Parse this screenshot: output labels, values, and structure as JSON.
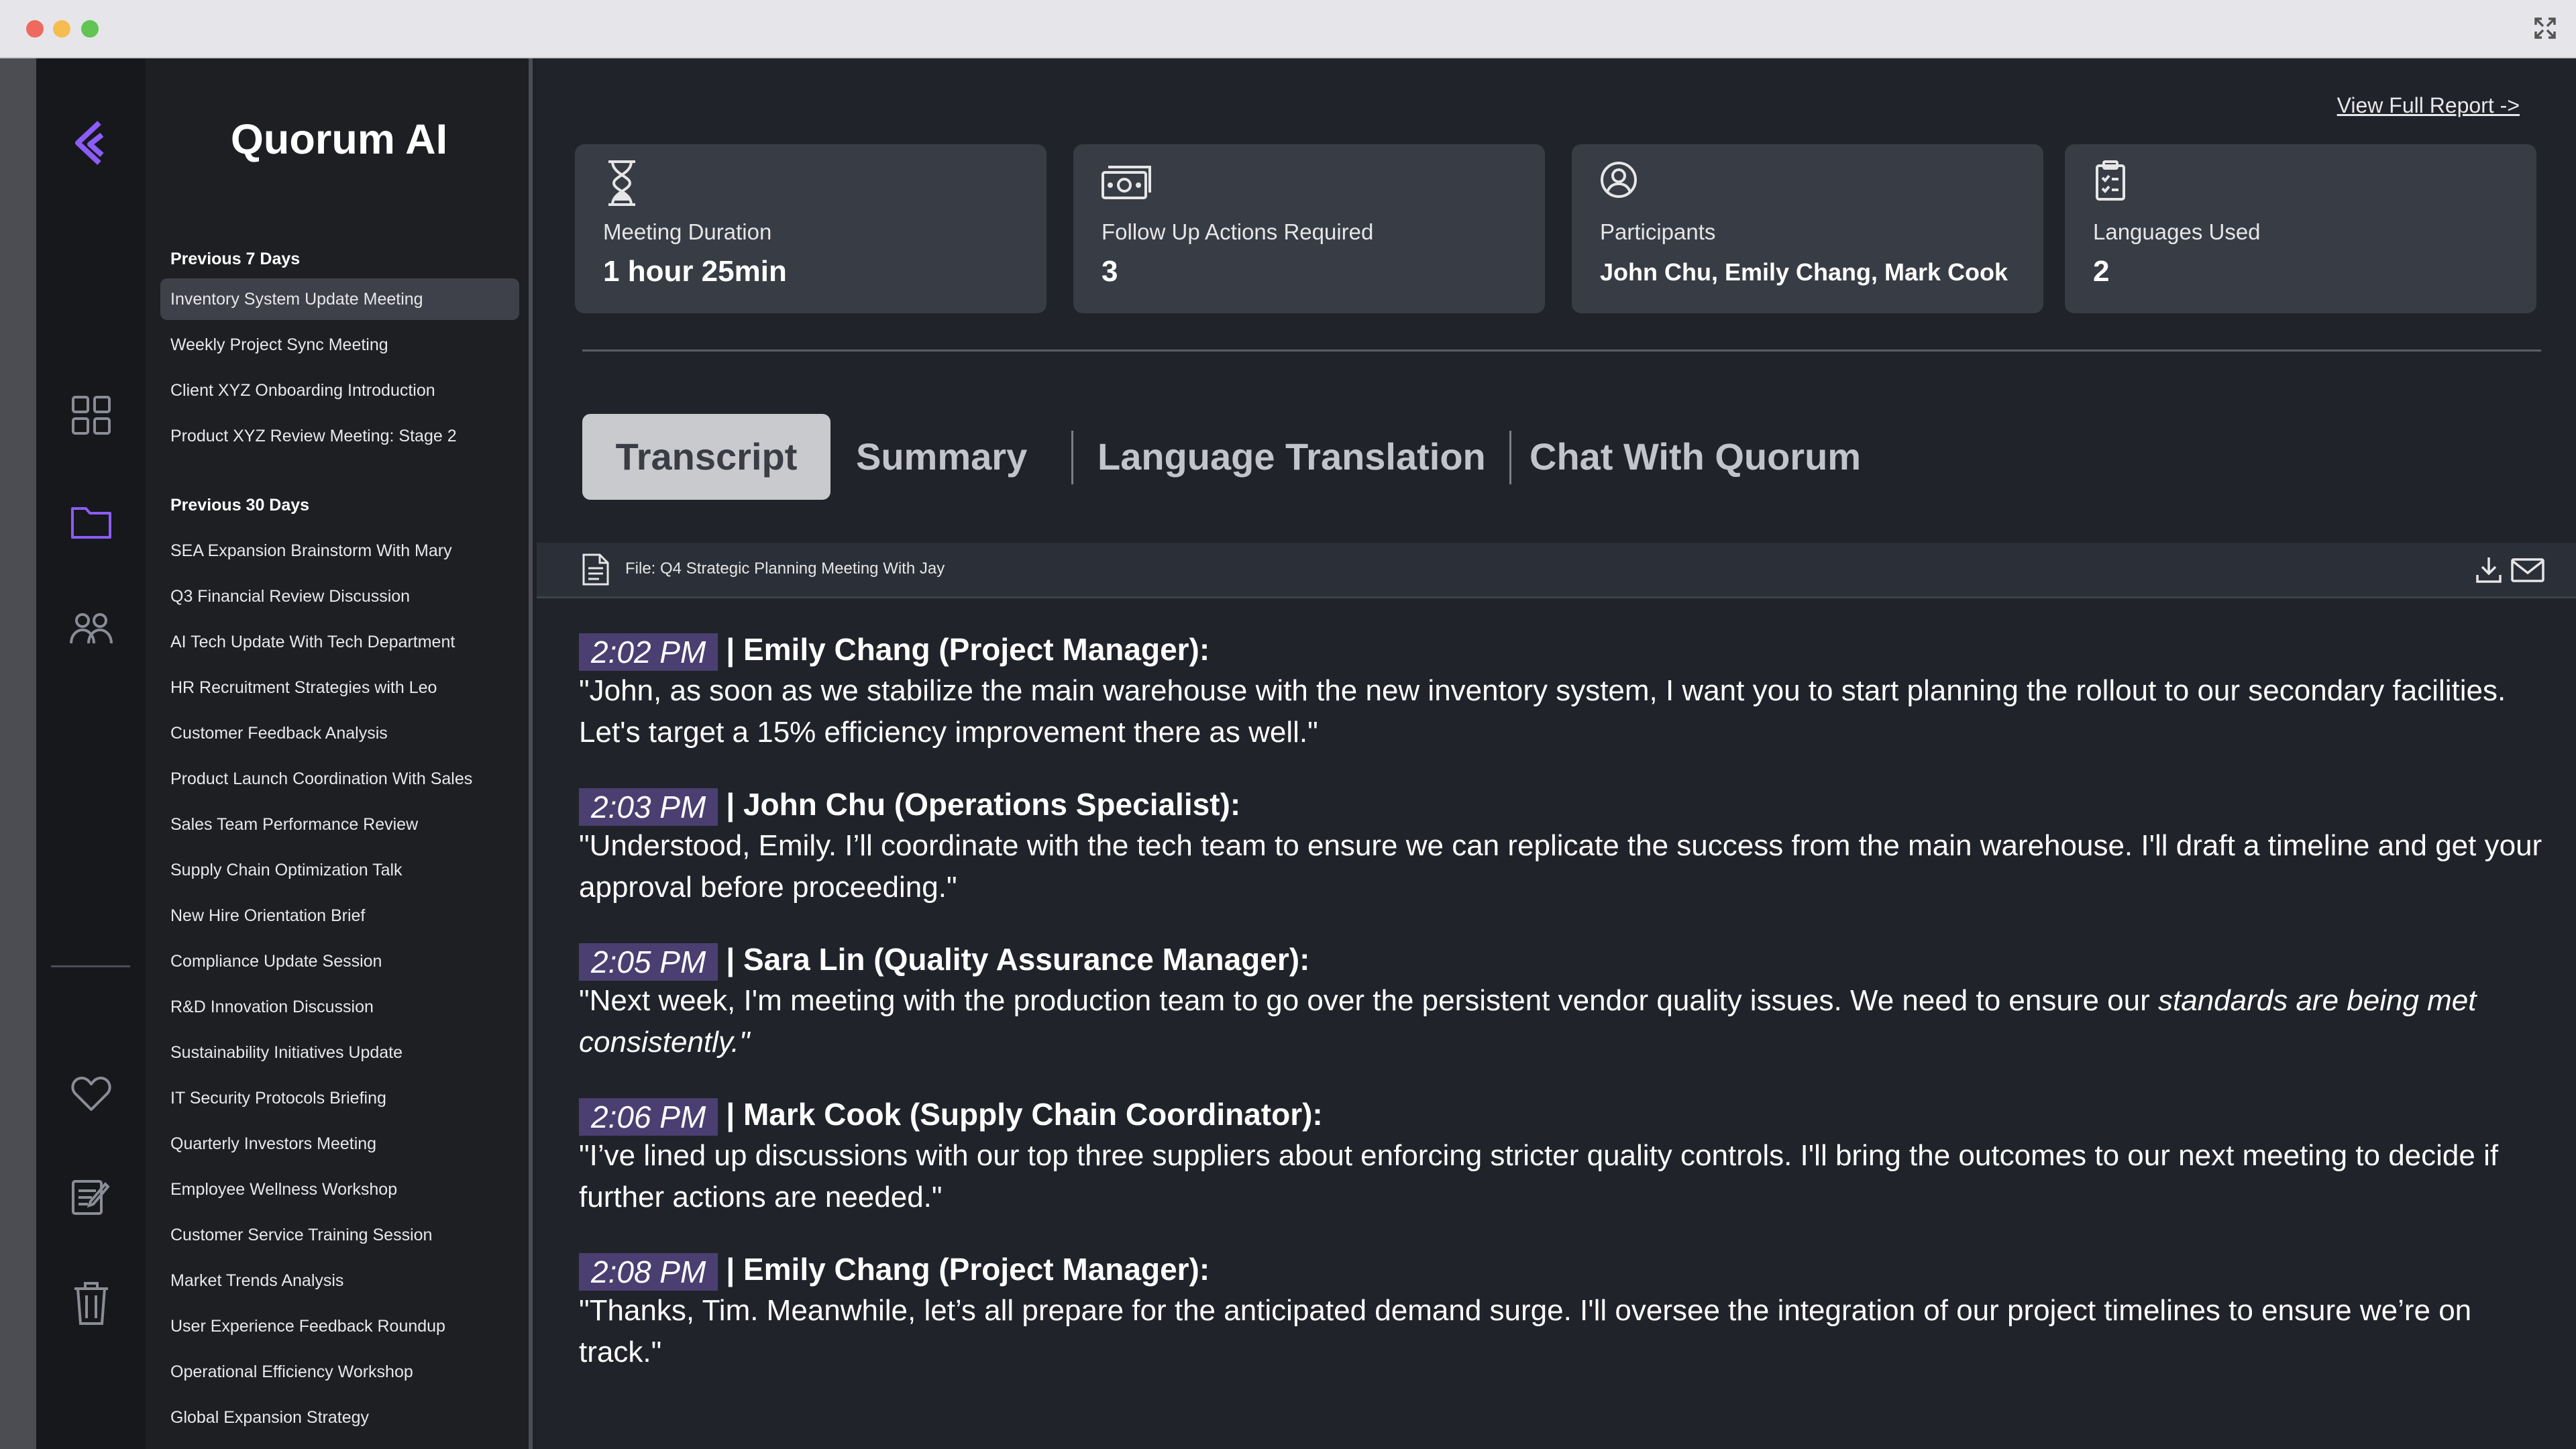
{
  "app": {
    "name": "Quorum AI",
    "accent": "#8b5cf6"
  },
  "sidebar": {
    "sections": [
      {
        "title": "Previous 7 Days",
        "items": [
          {
            "label": "Inventory System Update Meeting",
            "active": true
          },
          {
            "label": "Weekly Project Sync Meeting"
          },
          {
            "label": "Client XYZ Onboarding Introduction"
          },
          {
            "label": "Product XYZ Review Meeting: Stage 2"
          }
        ]
      },
      {
        "title": "Previous 30 Days",
        "items": [
          {
            "label": "SEA Expansion Brainstorm With Mary"
          },
          {
            "label": "Q3 Financial Review Discussion"
          },
          {
            "label": "AI Tech Update With Tech Department"
          },
          {
            "label": "HR Recruitment Strategies with Leo"
          },
          {
            "label": "Customer Feedback Analysis"
          },
          {
            "label": "Product Launch Coordination With Sales"
          },
          {
            "label": "Sales Team Performance Review"
          },
          {
            "label": "Supply Chain Optimization Talk"
          },
          {
            "label": "New Hire Orientation Brief"
          },
          {
            "label": "Compliance Update Session"
          },
          {
            "label": "R&D Innovation Discussion"
          },
          {
            "label": "Sustainability Initiatives Update"
          },
          {
            "label": "IT Security Protocols Briefing"
          },
          {
            "label": "Quarterly Investors Meeting"
          },
          {
            "label": "Employee Wellness Workshop"
          },
          {
            "label": "Customer Service Training Session"
          },
          {
            "label": "Market Trends Analysis"
          },
          {
            "label": "User Experience Feedback Roundup"
          },
          {
            "label": "Operational Efficiency Workshop"
          },
          {
            "label": "Global Expansion Strategy"
          }
        ]
      }
    ]
  },
  "rail": {
    "icons": [
      "quorum-logo-icon",
      "dashboard-grid-icon",
      "folder-icon",
      "users-icon",
      "heart-icon",
      "notes-edit-icon",
      "trash-icon"
    ]
  },
  "header": {
    "report_link": "View Full Report ->"
  },
  "stats": [
    {
      "icon": "hourglass-icon",
      "label": "Meeting Duration",
      "value": "1 hour 25min"
    },
    {
      "icon": "money-icon",
      "label": "Follow Up Actions Required",
      "value": "3"
    },
    {
      "icon": "user-circle-icon",
      "label": "Participants",
      "value": "John Chu, Emily Chang, Mark Cook"
    },
    {
      "icon": "clipboard-icon",
      "label": "Languages Used",
      "value": "2"
    }
  ],
  "tabs": [
    {
      "label": "Transcript",
      "active": true
    },
    {
      "label": "Summary"
    },
    {
      "label": "Language Translation"
    },
    {
      "label": "Chat With Quorum"
    }
  ],
  "file": {
    "name": "File: Q4 Strategic Planning Meeting With Jay"
  },
  "transcript": [
    {
      "time": "2:02 PM",
      "speaker": "| Emily Chang (Project Manager):",
      "text": "\"John, as soon as we stabilize the main warehouse with the new inventory system, I want you to start planning the rollout to our secondary facilities. Let's target a 15% efficiency improvement there as well.\""
    },
    {
      "time": "2:03 PM",
      "speaker": "| John Chu (Operations Specialist):",
      "text": "\"Understood, Emily. I’ll coordinate with the tech team to ensure we can replicate the success from the main warehouse. I'll draft a timeline and get your approval before proceeding.\""
    },
    {
      "time": "2:05 PM",
      "speaker": "| Sara Lin (Quality Assurance Manager):",
      "text": "\"Next week, I'm meeting with the production team to go over the persistent vendor quality issues. We need to ensure our ",
      "text_italic": "standards are being met consistently.\""
    },
    {
      "time": "2:06 PM",
      "speaker": "| Mark Cook (Supply Chain Coordinator):",
      "text": "\"I’ve lined up discussions with our top three suppliers about enforcing stricter quality controls. I'll bring the outcomes to our next meeting to decide if further actions are needed.\""
    },
    {
      "time": "2:08 PM",
      "speaker": "| Emily Chang (Project Manager):",
      "text": "\"Thanks, Tim. Meanwhile, let’s all prepare for the anticipated demand surge. I'll oversee the integration of our project timelines to ensure we’re on track.\""
    }
  ]
}
